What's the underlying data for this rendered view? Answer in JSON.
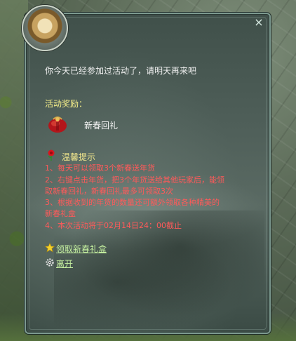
{
  "dialog": {
    "message": "你今天已经参加过活动了，请明天再来吧",
    "reward_title": "活动奖励：",
    "reward_item": "新春回礼",
    "tips_title": "温馨提示",
    "tips": [
      "1、每天可以领取3个新春送年货",
      "2、右键点击年货，把3个年货送给其他玩家后，能领",
      "取新春回礼，新春回礼最多可领取3次",
      "3、根据收到的年货的数量还可额外领取各种精美的",
      "新春礼盒",
      "4、本次活动将于02月14日24：00截止"
    ],
    "links": {
      "claim_gift_box": "领取新春礼盒",
      "leave": "离开"
    },
    "close_label": "×"
  },
  "colors": {
    "tips_red": "#ff5a5a",
    "title_yellow": "#f7f08a",
    "link_green": "#c5f0a0"
  },
  "icons": [
    "close-icon",
    "gift-bag-icon",
    "rose-icon",
    "star-icon",
    "gear-icon",
    "npc-avatar"
  ]
}
